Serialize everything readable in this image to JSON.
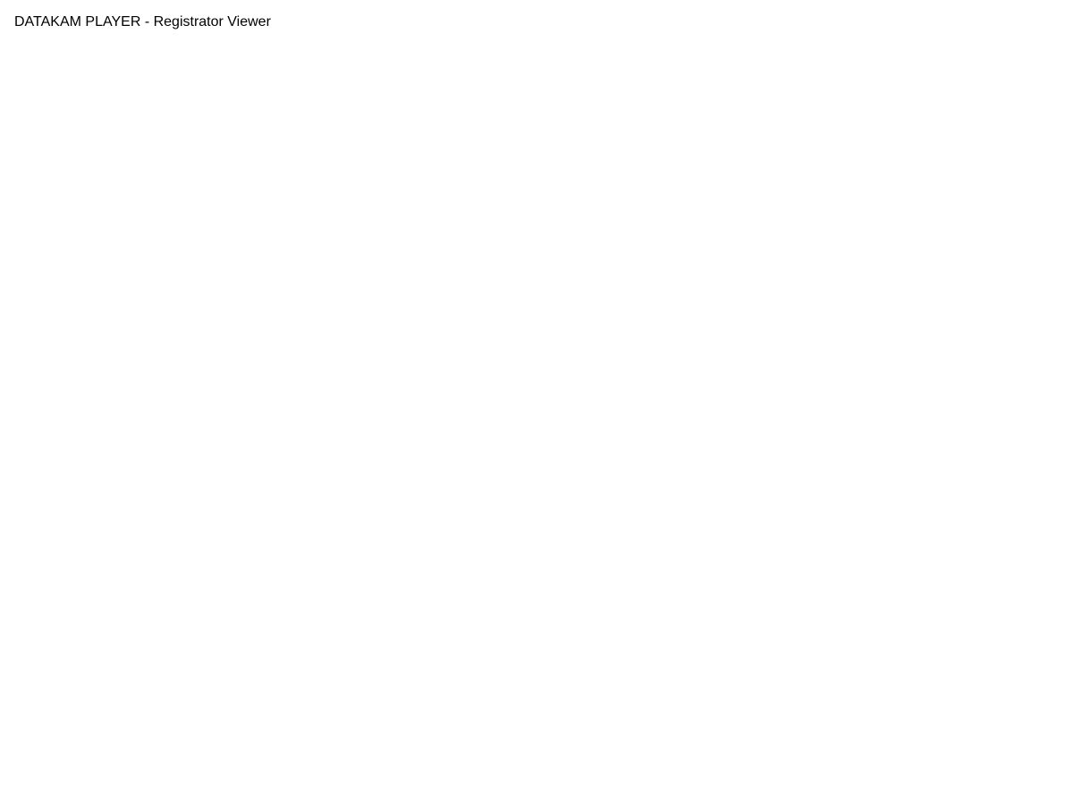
{
  "window_title": "DATAKAM PLAYER - Registrator Viewer"
}
